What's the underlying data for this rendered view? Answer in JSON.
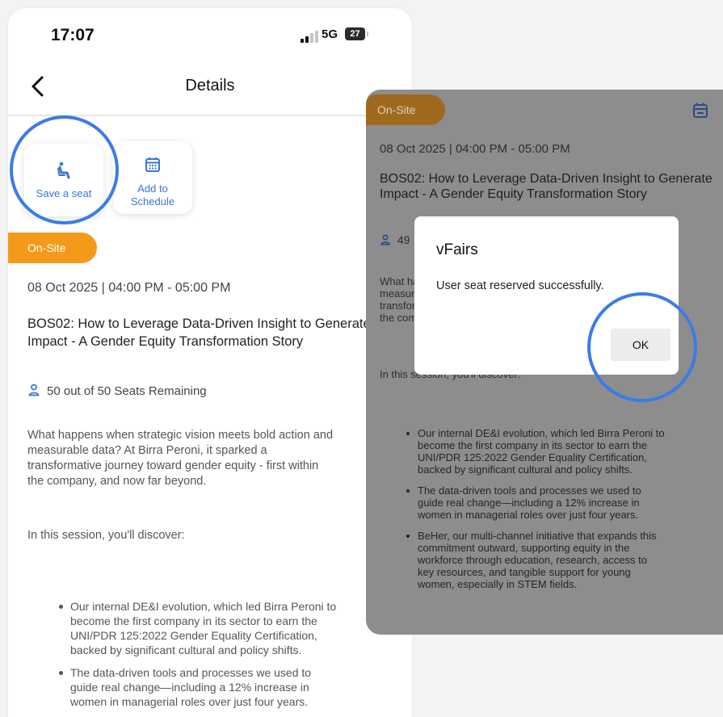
{
  "status_bar": {
    "time": "17:07",
    "network": "5G",
    "battery": "27"
  },
  "header": {
    "title": "Details"
  },
  "actions": {
    "save_seat": "Save a seat",
    "add_to_schedule_line1": "Add to",
    "add_to_schedule_line2": "Schedule"
  },
  "session": {
    "badge": "On-Site",
    "datetime": "08 Oct 2025 | 04:00 PM - 05:00 PM",
    "title": "BOS02: How to Leverage Data-Driven Insight to Generate Impact - A Gender Equity Transformation Story",
    "seats_left": "50 out of  50 Seats Remaining",
    "seats_right_partial": "49",
    "description_lines": [
      "What happens when strategic vision meets bold action and",
      "measurable data? At Birra Peroni, it sparked a",
      "transformative journey toward gender equity - first within",
      "the company, and now far beyond."
    ],
    "discover_label": "In this session, you'll discover:",
    "bullets_left": [
      [
        "Our internal DE&I evolution, which led Birra Peroni to",
        "become the first company in its sector to earn the",
        "UNI/PDR 125:2022 Gender Equality Certification,",
        "backed by significant cultural and policy shifts."
      ],
      [
        "The data-driven tools and processes we used to",
        "guide real change—including a 12% increase in",
        "women in managerial roles over just four years."
      ]
    ],
    "bullets_right": [
      [
        "Our internal DE&I evolution, which led Birra Peroni to",
        "become the first company in its sector to earn the",
        "UNI/PDR 125:2022 Gender Equality Certification,",
        "backed by significant cultural and policy shifts."
      ],
      [
        "The data-driven tools and processes we used to",
        "guide real change—including a 12% increase in",
        "women in managerial roles over just four years."
      ],
      [
        "BeHer, our multi-channel initiative that expands this",
        "commitment outward, supporting equity in the",
        "workforce through education, research, access to",
        "key resources, and tangible support for young",
        "women, especially in STEM fields."
      ]
    ]
  },
  "dialog": {
    "title": "vFairs",
    "message": "User seat reserved successfully.",
    "ok_label": "OK"
  },
  "colors": {
    "accent_blue": "#3a7ce8",
    "onsite_orange": "#f49a1a",
    "link_blue": "#3a76d1"
  }
}
